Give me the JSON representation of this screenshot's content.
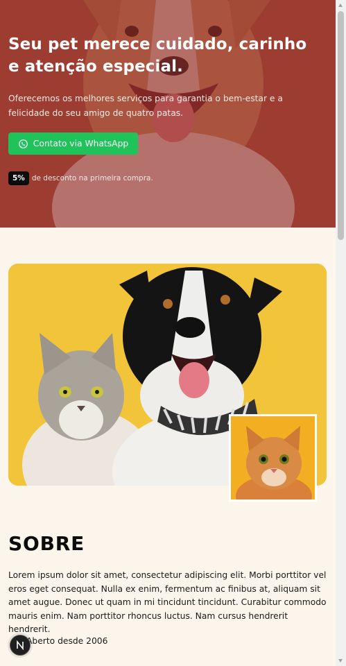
{
  "hero": {
    "title": "Seu pet merece cuidado, carinho e atenção especial.",
    "description": "Oferecemos os melhores serviços para garantia o bem-estar e a felicidade do seu amigo de quatro patas.",
    "whatsapp_button": "Contato via WhatsApp",
    "whatsapp_icon": "whatsapp-icon",
    "discount_badge": "5%",
    "discount_text": "de desconto na primeira compra."
  },
  "images": {
    "main": "dog-and-cat-photo",
    "secondary": "orange-cat-photo",
    "hero_background": "corgi-photo"
  },
  "about": {
    "title": "SOBRE",
    "text": "Lorem ipsum dolor sit amet, consectetur adipiscing elit. Morbi porttitor vel eros eget consequat. Nulla ex enim, fermentum ac finibus at, aliquam sit amet augue. Donec ut quam in mi tincidunt tincidunt. Curabitur commodo mauris enim. Nam porttitor rhoncus luctus. Nam cursus hendrerit hendrerit.",
    "since": "Aberto desde 2006"
  },
  "floating_button": {
    "label": "N"
  },
  "colors": {
    "hero_overlay": "#8e2a28",
    "whatsapp_green": "#20c25a",
    "page_background": "#fcf5ec",
    "photo_background": "#f2c43a"
  }
}
